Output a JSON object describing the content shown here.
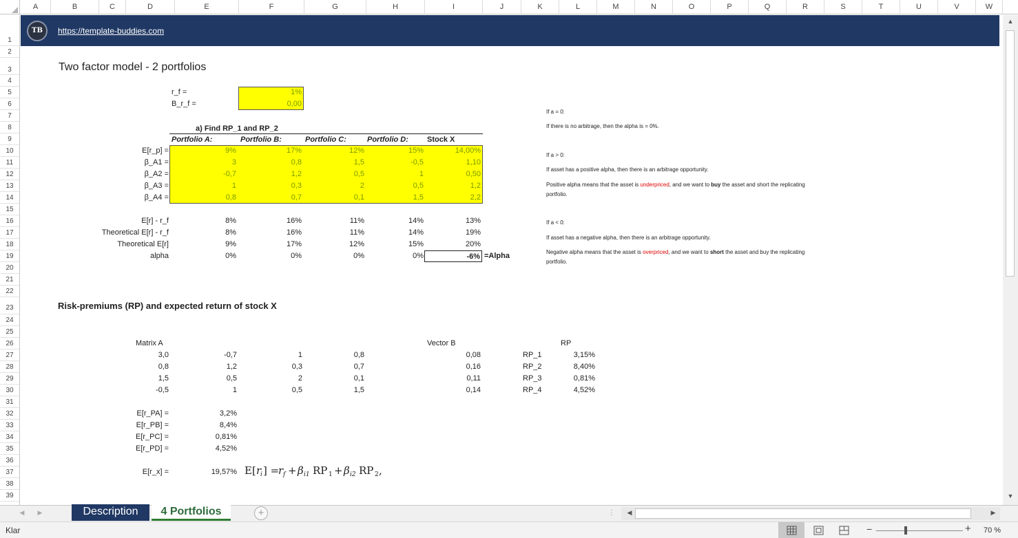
{
  "columns": [
    "A",
    "B",
    "C",
    "D",
    "E",
    "F",
    "G",
    "H",
    "I",
    "J",
    "K",
    "L",
    "M",
    "N",
    "O",
    "P",
    "Q",
    "R",
    "S",
    "T",
    "U",
    "V",
    "W"
  ],
  "rows": [
    "1",
    "2",
    "3",
    "4",
    "5",
    "6",
    "7",
    "8",
    "9",
    "10",
    "11",
    "12",
    "13",
    "14",
    "15",
    "16",
    "17",
    "18",
    "19",
    "20",
    "21",
    "22",
    "23",
    "24",
    "25",
    "26",
    "27",
    "28",
    "29",
    "30",
    "31",
    "32",
    "33",
    "34",
    "35",
    "36",
    "37",
    "38",
    "39"
  ],
  "banner": {
    "logo_text": "TB",
    "link": "https://template-buddies.com"
  },
  "title": "Two factor model - 2 portfolios",
  "rf": {
    "rf_label": "r_f =",
    "rf_value": "1%",
    "brf_label": "Β_r_f =",
    "brf_value": "0,00"
  },
  "sectionA": {
    "heading": "a) Find RP_1 and RP_2",
    "headers": [
      "Portfolio A:",
      "Portfolio B:",
      "Portfolio C:",
      "Portfolio D:",
      "Stock X"
    ]
  },
  "betaTable": {
    "labels": [
      "E[r_p] =",
      "β_A1 =",
      "β_A2 =",
      "β_A3 =",
      "β_A4 ="
    ],
    "rows": [
      [
        "9%",
        "17%",
        "12%",
        "15%",
        "14,00%"
      ],
      [
        "3",
        "0,8",
        "1,5",
        "-0,5",
        "1,10"
      ],
      [
        "-0,7",
        "1,2",
        "0,5",
        "1",
        "0,50"
      ],
      [
        "1",
        "0,3",
        "2",
        "0,5",
        "1,2"
      ],
      [
        "0,8",
        "0,7",
        "0,1",
        "1,5",
        "2,2"
      ]
    ]
  },
  "calcTable": {
    "labels": [
      "E[r] - r_f",
      "Theoretical E[r] - r_f",
      "Theoretical E[r]",
      "alpha"
    ],
    "rows": [
      [
        "8%",
        "16%",
        "11%",
        "14%",
        "13%"
      ],
      [
        "8%",
        "16%",
        "11%",
        "14%",
        "19%"
      ],
      [
        "9%",
        "17%",
        "12%",
        "15%",
        "20%"
      ],
      [
        "0%",
        "0%",
        "0%",
        "0%",
        "-6%"
      ]
    ],
    "alpha_tag": "=Alpha"
  },
  "notes": {
    "a0_head": "If a = 0:",
    "a0_text": "If there is no arbitrage, then the alpha is = 0%.",
    "apos_head": "If a > 0:",
    "apos_text": "If asset has a positive alpha, then there is an arbitrage opportunity.",
    "apos_l1a": "Positive alpha means that the asset is ",
    "apos_l1b": "underpriced",
    "apos_l1c": ", and we want to ",
    "apos_l1d": "buy",
    "apos_l1e": " the asset and short the replicating",
    "apos_l2": "portfolio.",
    "aneg_head": "If a < 0:",
    "aneg_text": "If asset has a negative alpha, then there is an arbitrage opportunity.",
    "aneg_l1a": "Negative alpha means that the asset is ",
    "aneg_l1b": "overpriced",
    "aneg_l1c": ", and we want to ",
    "aneg_l1d": "short",
    "aneg_l1e": " the asset and buy the replicating",
    "aneg_l2": "portfolio."
  },
  "rpSection": {
    "heading": "Risk-premiums (RP) and expected return of stock X",
    "matrix_label": "Matrix A",
    "matrix": [
      [
        "3,0",
        "-0,7",
        "1",
        "0,8"
      ],
      [
        "0,8",
        "1,2",
        "0,3",
        "0,7"
      ],
      [
        "1,5",
        "0,5",
        "2",
        "0,1"
      ],
      [
        "-0,5",
        "1",
        "0,5",
        "1,5"
      ]
    ],
    "vector_label": "Vector B",
    "vector": [
      "0,08",
      "0,16",
      "0,11",
      "0,14"
    ],
    "rp_header": "RP",
    "rp_names": [
      "RP_1",
      "RP_2",
      "RP_3",
      "RP_4"
    ],
    "rp_values": [
      "3,15%",
      "8,40%",
      "0,81%",
      "4,52%"
    ]
  },
  "expected": {
    "labels": [
      "E[r_PA] =",
      "E[r_PB] =",
      "E[r_PC] =",
      "E[r_PD] ="
    ],
    "values": [
      "3,2%",
      "8,4%",
      "0,81%",
      "4,52%"
    ],
    "erx_label": "E[r_x] =",
    "erx_value": "19,57%"
  },
  "tabs": {
    "description": "Description",
    "portfolios": "4 Portfolios",
    "add": "+"
  },
  "status": {
    "ready": "Klar",
    "zoom": "70 %"
  }
}
